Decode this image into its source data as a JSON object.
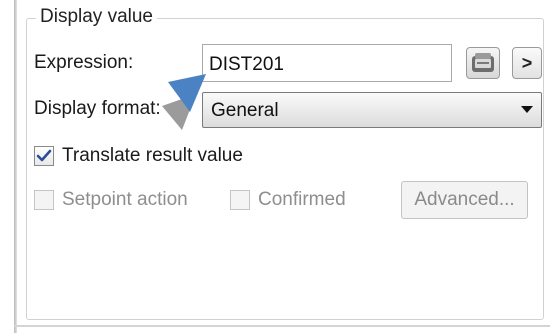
{
  "group": {
    "legend": "Display value"
  },
  "expression": {
    "label": "Expression:",
    "value": "DIST201",
    "browse_icon": "expression-editor-icon",
    "more_label": ">"
  },
  "display_format": {
    "label": "Display format:",
    "selected": "General"
  },
  "options": {
    "translate_label": "Translate result value",
    "translate_checked": true,
    "setpoint_label": "Setpoint action",
    "setpoint_checked": false,
    "confirmed_label": "Confirmed",
    "confirmed_checked": false,
    "advanced_label": "Advanced..."
  },
  "colors": {
    "accent_pointer": "#4a82c4",
    "pointer_shadow": "#8a8a8a",
    "disabled_text": "#8e8e8e"
  }
}
